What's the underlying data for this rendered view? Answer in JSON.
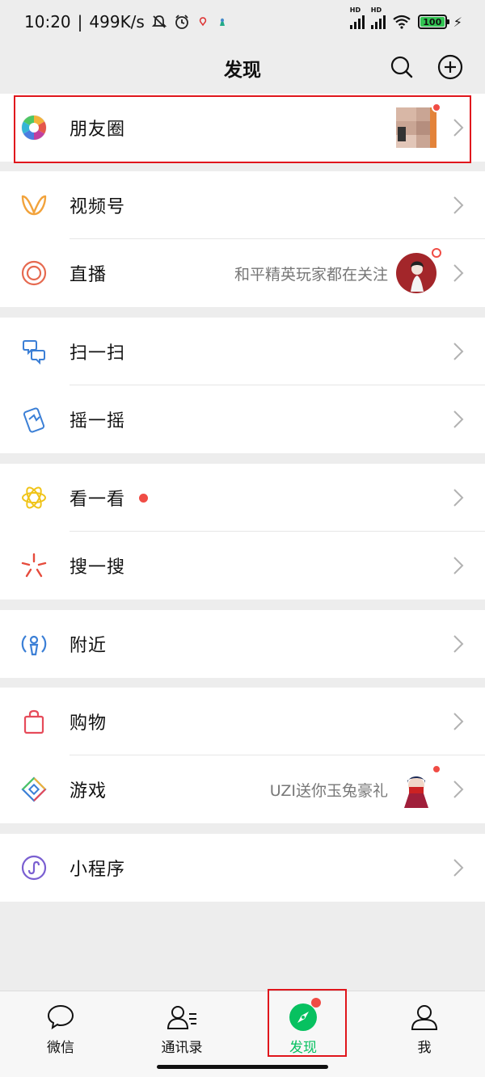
{
  "status_bar": {
    "time": "10:20",
    "net_speed": "499K/s",
    "battery": "100",
    "signal_tag": "HD"
  },
  "nav": {
    "title": "发现"
  },
  "groups": [
    {
      "items": [
        {
          "label": "朋友圈",
          "icon": "moments-icon",
          "has_thumb": true,
          "thumb_badge": true
        }
      ]
    },
    {
      "items": [
        {
          "label": "视频号",
          "icon": "channels-icon"
        },
        {
          "label": "直播",
          "icon": "live-icon",
          "sub": "和平精英玩家都在关注",
          "has_thumb": true,
          "thumb_badge": true
        }
      ]
    },
    {
      "items": [
        {
          "label": "扫一扫",
          "icon": "scan-icon"
        },
        {
          "label": "摇一摇",
          "icon": "shake-icon"
        }
      ]
    },
    {
      "items": [
        {
          "label": "看一看",
          "icon": "top-stories-icon",
          "inline_dot": true
        },
        {
          "label": "搜一搜",
          "icon": "search-search-icon"
        }
      ]
    },
    {
      "items": [
        {
          "label": "附近",
          "icon": "nearby-icon"
        }
      ]
    },
    {
      "items": [
        {
          "label": "购物",
          "icon": "shopping-icon"
        },
        {
          "label": "游戏",
          "icon": "games-icon",
          "sub": "UZI送你玉兔豪礼",
          "has_thumb": true,
          "thumb_badge": true
        }
      ]
    },
    {
      "items": [
        {
          "label": "小程序",
          "icon": "mini-programs-icon"
        }
      ]
    }
  ],
  "tabs": [
    {
      "label": "微信",
      "icon": "chat-bubble-icon"
    },
    {
      "label": "通讯录",
      "icon": "contacts-icon"
    },
    {
      "label": "发现",
      "icon": "compass-icon",
      "active": true,
      "badge": true
    },
    {
      "label": "我",
      "icon": "person-icon"
    }
  ],
  "colors": {
    "accent": "#07c160",
    "badge": "#f04c45",
    "highlight": "#e0161c",
    "background": "#ededed"
  }
}
